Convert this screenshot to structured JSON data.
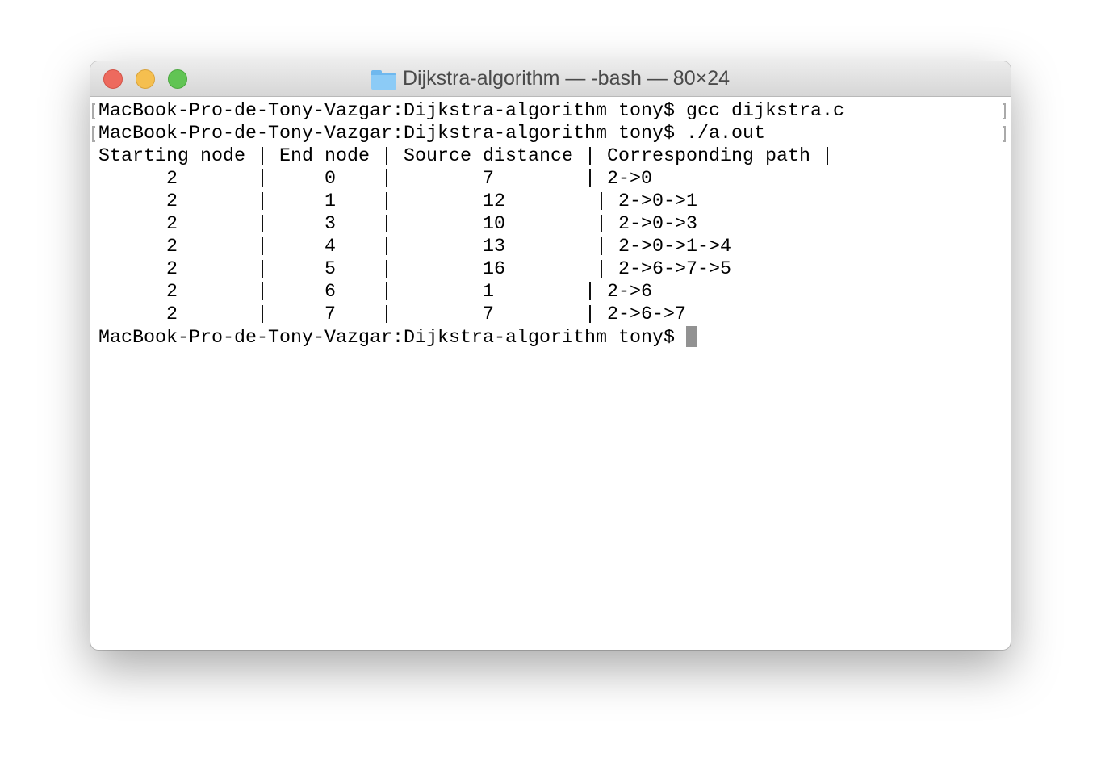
{
  "window": {
    "title": "Dijkstra-algorithm — -bash — 80×24",
    "title_icon": "folder-icon",
    "traffic_lights": {
      "close": "#ed6a5e",
      "minimize": "#f5bf4f",
      "zoom": "#61c454"
    }
  },
  "terminal": {
    "prompt_lines": [
      "MacBook-Pro-de-Tony-Vazgar:Dijkstra-algorithm tony$ gcc dijkstra.c",
      "MacBook-Pro-de-Tony-Vazgar:Dijkstra-algorithm tony$ ./a.out"
    ],
    "output_lines": [
      "Starting node | End node | Source distance | Corresponding path |",
      "      2       |     0    |        7        | 2->0",
      "      2       |     1    |        12        | 2->0->1",
      "      2       |     3    |        10        | 2->0->3",
      "      2       |     4    |        13        | 2->0->1->4",
      "      2       |     5    |        16        | 2->6->7->5",
      "      2       |     6    |        1        | 2->6",
      "      2       |     7    |        7        | 2->6->7"
    ],
    "current_prompt": "MacBook-Pro-de-Tony-Vazgar:Dijkstra-algorithm tony$ "
  }
}
